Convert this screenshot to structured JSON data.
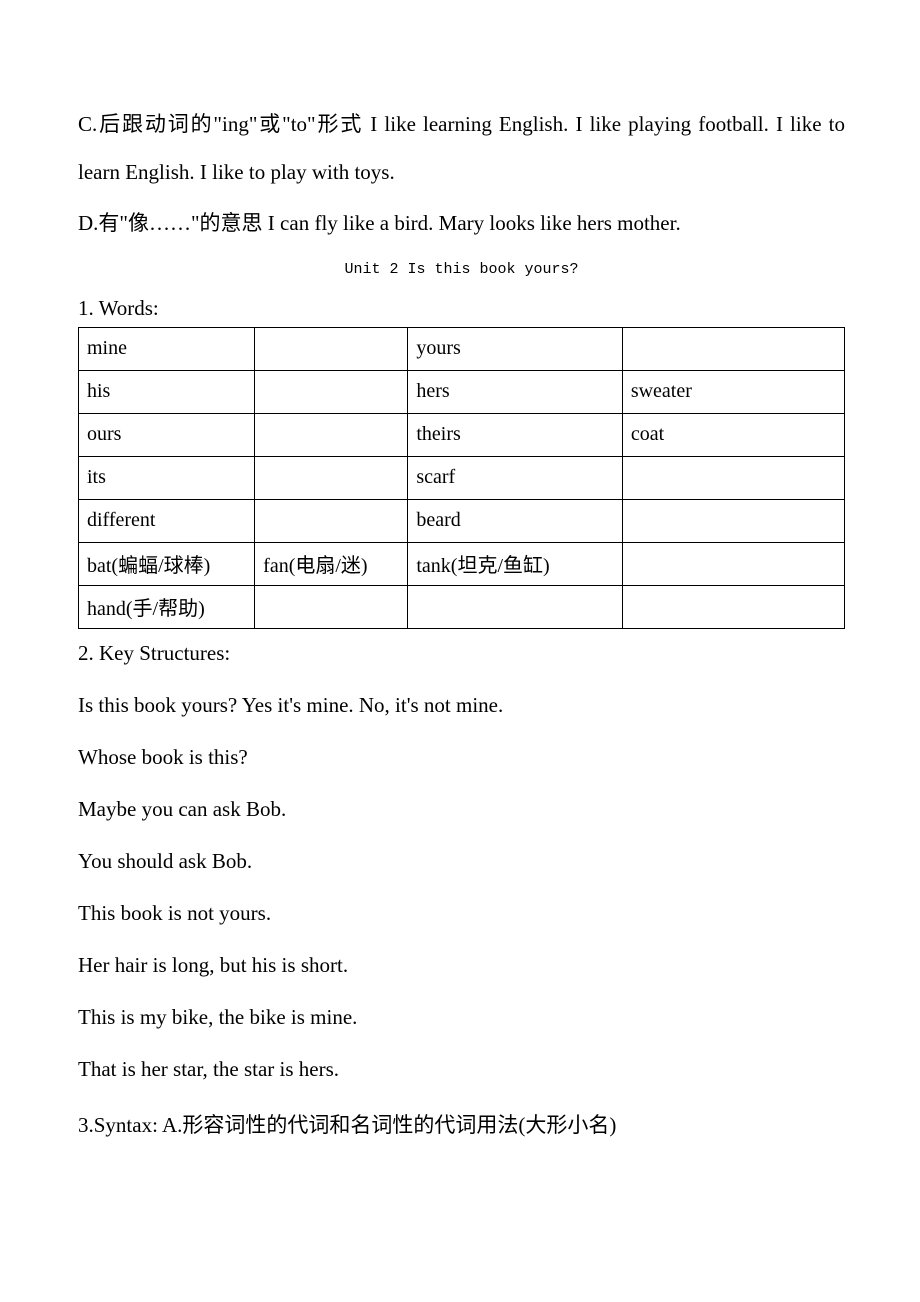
{
  "para_c": "C.后跟动词的\"ing\"或\"to\"形式   I like learning English. I like playing football.   I like to learn English.   I like to play with toys.",
  "para_d": "D.有\"像……\"的意思   I can fly like a bird.   Mary looks like hers mother.",
  "unit_title": "Unit 2 Is this book yours?",
  "words_label": "1.  Words:",
  "words_table": [
    [
      "mine",
      "",
      "yours",
      ""
    ],
    [
      "his",
      "",
      "hers",
      "sweater"
    ],
    [
      "ours",
      "",
      "theirs",
      "coat"
    ],
    [
      "its",
      "",
      "scarf",
      ""
    ],
    [
      "different",
      "",
      "beard",
      ""
    ],
    [
      "bat(蝙蝠/球棒)",
      "fan(电扇/迷)",
      "tank(坦克/鱼缸)",
      ""
    ],
    [
      "hand(手/帮助)",
      "",
      "",
      ""
    ]
  ],
  "key_structures_label": "2.  Key Structures:",
  "ks_lines": [
    "Is this book yours?   Yes it's mine.   No, it's not mine.",
    "Whose book is this?",
    "Maybe you can ask Bob.",
    "You should ask Bob.",
    "This book is not yours.",
    "Her hair is long, but his is short.",
    "This is my bike, the bike is mine.",
    "That is her star, the star is hers."
  ],
  "syntax_line": "3.Syntax:   A.形容词性的代词和名词性的代词用法(大形小名)"
}
